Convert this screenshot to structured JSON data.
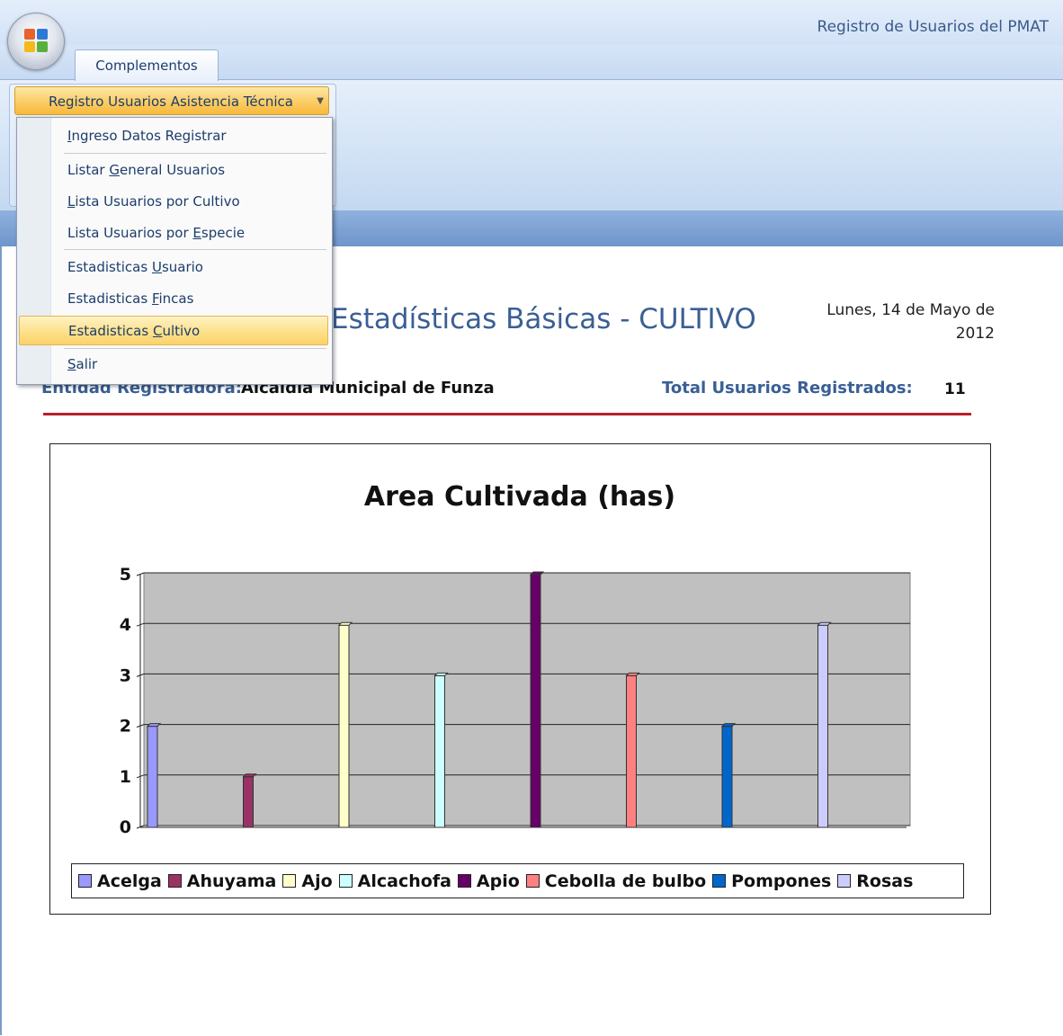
{
  "app": {
    "title": "Registro de Usuarios del PMAT"
  },
  "ribbon": {
    "tab_label": "Complementos",
    "dropdown_label": "Registro Usuarios Asistencia Técnica"
  },
  "menu": {
    "items": [
      {
        "pre": "",
        "key": "I",
        "post": "ngreso Datos Registrar"
      },
      {
        "pre": "Listar ",
        "key": "G",
        "post": "eneral Usuarios"
      },
      {
        "pre": "",
        "key": "L",
        "post": "ista Usuarios por Cultivo"
      },
      {
        "pre": "Lista Usuarios por ",
        "key": "E",
        "post": "specie"
      },
      {
        "pre": "Estadisticas ",
        "key": "U",
        "post": "suario"
      },
      {
        "pre": "Estadisticas ",
        "key": "F",
        "post": "incas"
      },
      {
        "pre": "Estadisticas ",
        "key": "C",
        "post": "ultivo"
      },
      {
        "pre": "",
        "key": "S",
        "post": "alir"
      }
    ],
    "highlighted_index": 6
  },
  "report": {
    "heading": "Estadísticas Básicas - CULTIVO",
    "date_line1": "Lunes, 14 de Mayo de",
    "date_line2": "2012",
    "entidad_label": "Entidad Registradora:",
    "entidad_value": "Alcaldia Municipal de Funza",
    "total_label": "Total Usuarios Registrados:",
    "total_value": "11"
  },
  "colors": {
    "accent_red": "#b8202a",
    "heading_blue": "#3a5f94",
    "plot_bg": "#c0c0c0"
  },
  "chart_data": {
    "type": "bar",
    "title": "Area Cultivada (has)",
    "xlabel": "",
    "ylabel": "",
    "ylim": [
      0,
      5
    ],
    "yticks": [
      "0",
      "1",
      "2",
      "3",
      "4",
      "5"
    ],
    "grid": true,
    "legend_position": "bottom",
    "series": [
      {
        "name": "Acelga",
        "values": [
          2
        ],
        "color": "#9999ff"
      },
      {
        "name": "Ahuyama",
        "values": [
          1
        ],
        "color": "#993366"
      },
      {
        "name": "Ajo",
        "values": [
          4
        ],
        "color": "#ffffcc"
      },
      {
        "name": "Alcachofa",
        "values": [
          3
        ],
        "color": "#ccffff"
      },
      {
        "name": "Apio",
        "values": [
          5
        ],
        "color": "#660066"
      },
      {
        "name": "Cebolla de bulbo",
        "values": [
          3
        ],
        "color": "#ff8080"
      },
      {
        "name": "Pompones",
        "values": [
          2
        ],
        "color": "#0066cc"
      },
      {
        "name": "Rosas",
        "values": [
          4
        ],
        "color": "#ccccff"
      }
    ]
  }
}
